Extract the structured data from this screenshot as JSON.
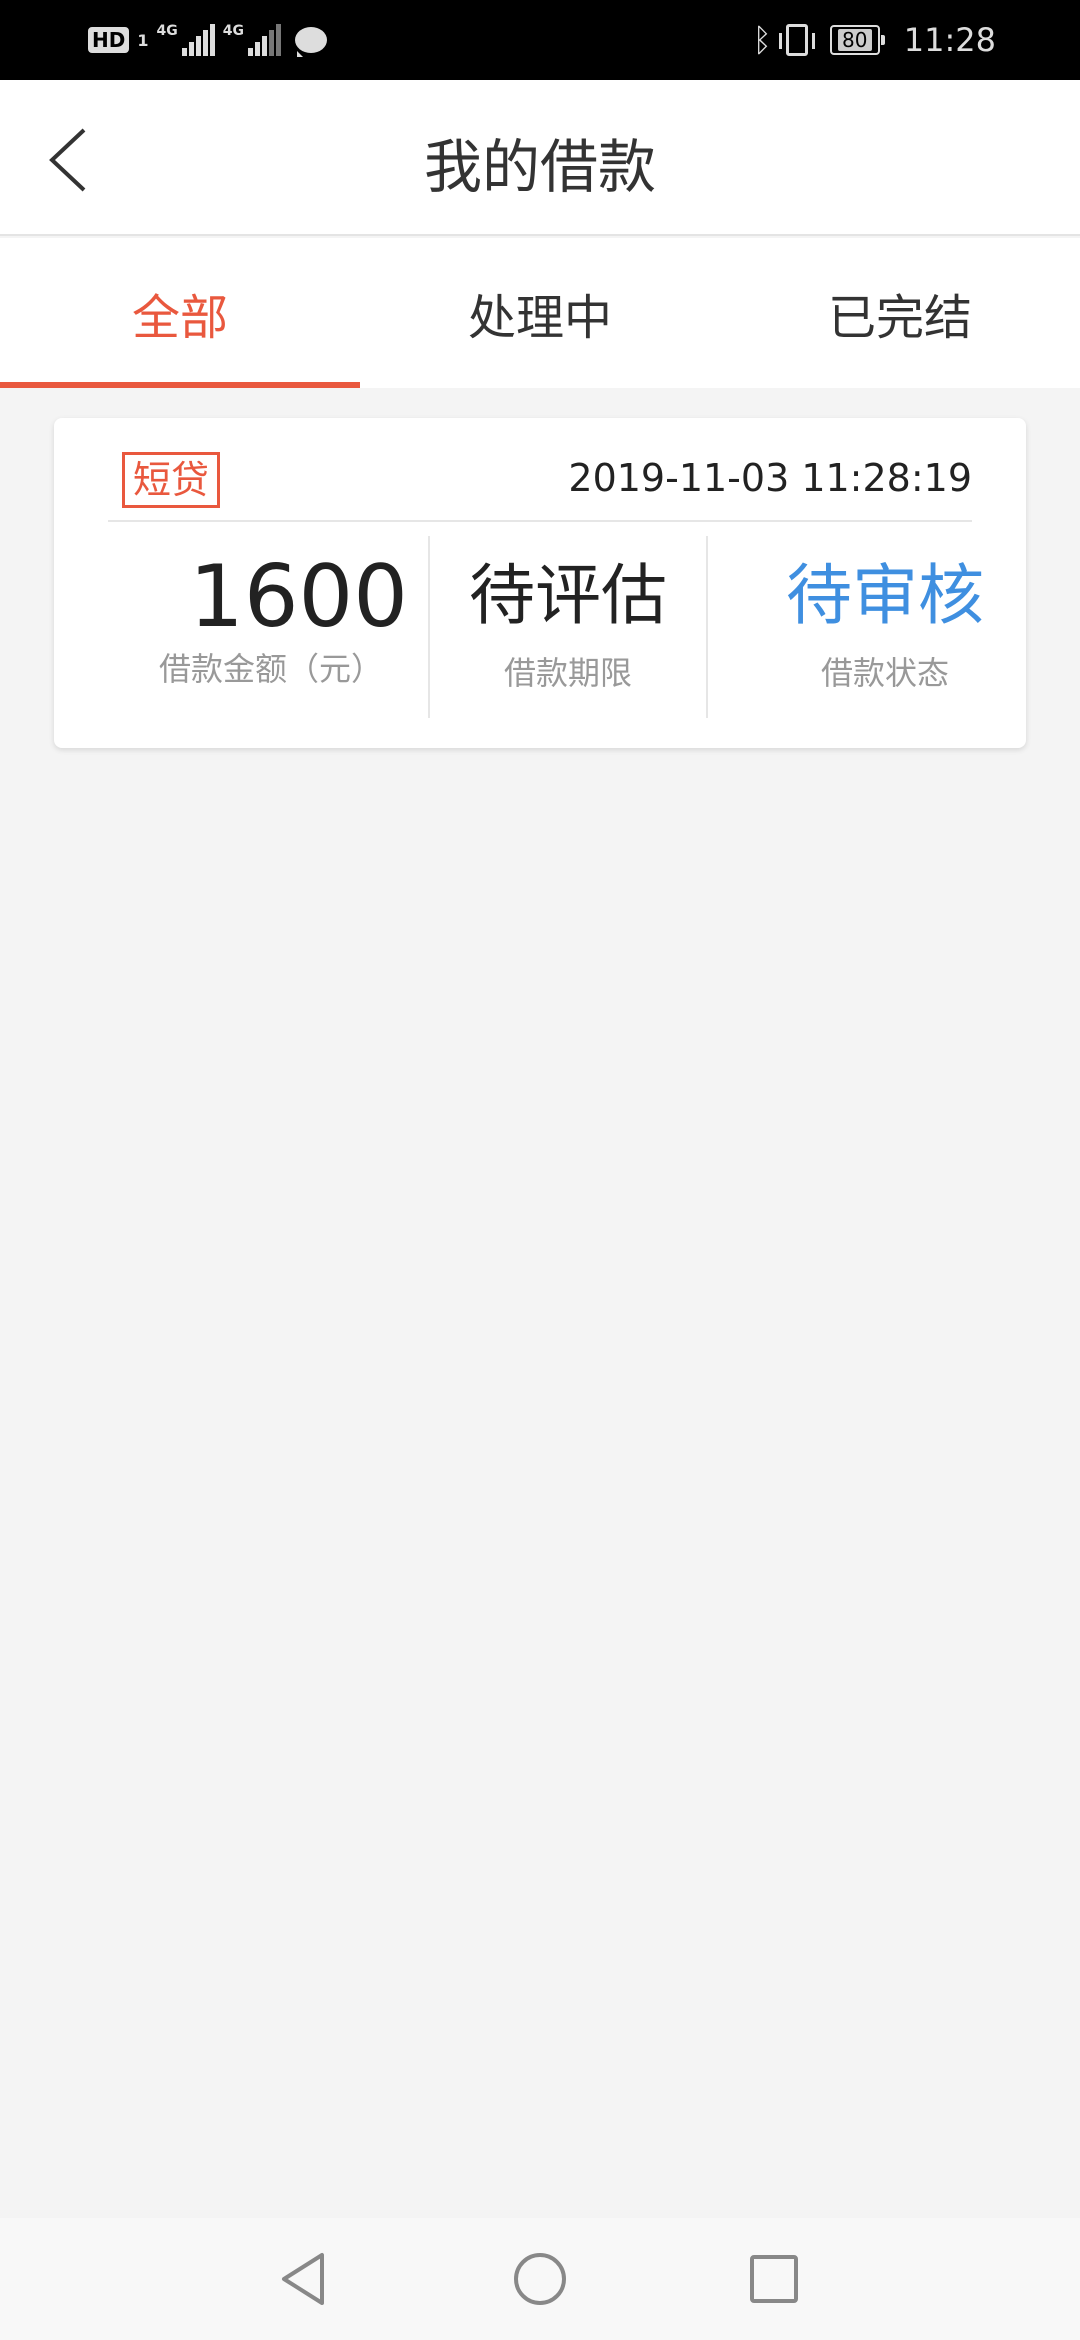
{
  "status_bar": {
    "network1": "4G",
    "network2": "4G",
    "battery": "80",
    "time": "11:28",
    "hd": "HD",
    "hd_sim": "1"
  },
  "header": {
    "title": "我的借款"
  },
  "tabs": [
    {
      "label": "全部",
      "active": true
    },
    {
      "label": "处理中",
      "active": false
    },
    {
      "label": "已完结",
      "active": false
    }
  ],
  "loan": {
    "type_tag": "短贷",
    "datetime": "2019-11-03 11:28:19",
    "amount_value": "1600",
    "amount_label": "借款金额（元）",
    "term_value": "待评估",
    "term_label": "借款期限",
    "status_value": "待审核",
    "status_label": "借款状态"
  },
  "colors": {
    "accent": "#e9583e",
    "status_blue": "#3f8fe0"
  }
}
